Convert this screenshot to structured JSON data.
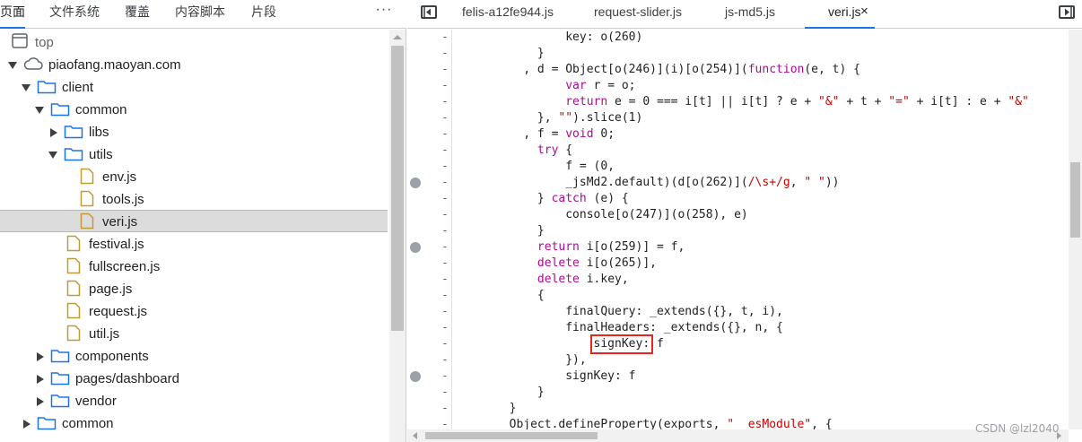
{
  "navigator": {
    "tabs": [
      {
        "label": "页面",
        "active": true
      },
      {
        "label": "文件系统",
        "active": false
      },
      {
        "label": "覆盖",
        "active": false
      },
      {
        "label": "内容脚本",
        "active": false
      },
      {
        "label": "片段",
        "active": false
      }
    ],
    "more_label": "···",
    "tree": [
      {
        "label": "top",
        "type": "frame",
        "expanded": true
      },
      {
        "label": "piaofang.maoyan.com",
        "type": "cloud",
        "expanded": true
      },
      {
        "label": "client",
        "type": "folder",
        "expanded": true
      },
      {
        "label": "common",
        "type": "folder",
        "expanded": true
      },
      {
        "label": "libs",
        "type": "folder",
        "expanded": false
      },
      {
        "label": "utils",
        "type": "folder",
        "expanded": true
      },
      {
        "label": "env.js",
        "type": "file"
      },
      {
        "label": "tools.js",
        "type": "file"
      },
      {
        "label": "veri.js",
        "type": "file",
        "selected": true
      },
      {
        "label": "festival.js",
        "type": "file"
      },
      {
        "label": "fullscreen.js",
        "type": "file"
      },
      {
        "label": "page.js",
        "type": "file"
      },
      {
        "label": "request.js",
        "type": "file"
      },
      {
        "label": "util.js",
        "type": "file"
      },
      {
        "label": "components",
        "type": "folder",
        "expanded": false
      },
      {
        "label": "pages/dashboard",
        "type": "folder",
        "expanded": false
      },
      {
        "label": "vendor",
        "type": "folder",
        "expanded": false
      },
      {
        "label": "common",
        "type": "folder",
        "expanded": false
      }
    ]
  },
  "editor": {
    "tabs": [
      {
        "label": "felis-a12fe944.js",
        "active": false
      },
      {
        "label": "request-slider.js",
        "active": false
      },
      {
        "label": "js-md5.js",
        "active": false
      },
      {
        "label": "veri.js",
        "active": true
      }
    ],
    "close_label": "×",
    "breakpoint_lines": [
      9,
      13,
      21
    ],
    "highlighted_text": "signKey:",
    "lines": [
      "                key: o(260)",
      "            }",
      "          , d = Object[o(246)](i)[o(254)](function(e, t) {",
      "                var r = o;",
      "                return e = 0 === i[t] || i[t] ? e + \"&\" + t + \"=\" + i[t] : e + \"&\"",
      "            }, \"\").slice(1)",
      "          , f = void 0;",
      "            try {",
      "                f = (0,",
      "                _jsMd2.default)(d[o(262)](/\\s+/g, \" \"))",
      "            } catch (e) {",
      "                console[o(247)](o(258), e)",
      "            }",
      "            return i[o(259)] = f,",
      "            delete i[o(265)],",
      "            delete i.key,",
      "            {",
      "                finalQuery: _extends({}, t, i),",
      "                finalHeaders: _extends({}, n, {",
      "                    signKey: f",
      "                }),",
      "                signKey: f",
      "            }",
      "        }",
      "        Object.defineProperty(exports, \"__esModule\", {"
    ]
  },
  "watermark": "CSDN @lzl2040",
  "colors": {
    "accent": "#1a73e8",
    "keyword": "#aa0d91",
    "string": "#c80000",
    "highlight_box": "#e5261e"
  }
}
